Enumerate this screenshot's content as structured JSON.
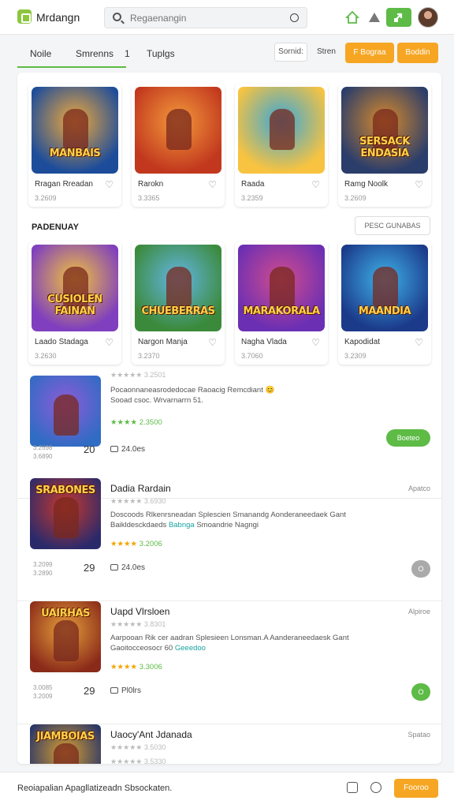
{
  "app": {
    "brand": "Mrdangn"
  },
  "search": {
    "placeholder": "Regaenangin"
  },
  "tabs": [
    "Noile",
    "Smrenns",
    "1",
    "Tuplgs"
  ],
  "toolbar": {
    "filter_label": "Sornid:",
    "filter_value": "Stren",
    "btn1": "F Bograa",
    "btn2": "Boddin"
  },
  "featured": [
    {
      "name": "Rragan Rreadan",
      "count": "3.2609",
      "art": "MANBAIS",
      "colors": [
        "#1d4d9a",
        "#f2a93b"
      ]
    },
    {
      "name": "Rarokn",
      "count": "3.3365",
      "art": "",
      "colors": [
        "#c2381e",
        "#f39a3b"
      ]
    },
    {
      "name": "Raada",
      "count": "3.2359",
      "art": "",
      "colors": [
        "#f7c341",
        "#3aa6d8"
      ]
    },
    {
      "name": "Ramg Noolk",
      "count": "3.2609",
      "art": "SERSACK ENDASIA",
      "colors": [
        "#2a3d6b",
        "#d88a2b"
      ]
    }
  ],
  "section": {
    "title": "PADENUAY",
    "button": "PESC GUNABAS"
  },
  "second": [
    {
      "name": "Laado Stadaga",
      "count": "3.2630",
      "art": "CUSIOLEN FAINAN",
      "colors": [
        "#7f3fbf",
        "#f3c33b"
      ]
    },
    {
      "name": "Nargon Manja",
      "count": "3.2370",
      "art": "CHUEBERRAS",
      "colors": [
        "#3b8a3b",
        "#64b6e6"
      ]
    },
    {
      "name": "Nagha Vlada",
      "count": "3.7060",
      "art": "MARAKORALA",
      "colors": [
        "#6b2fb3",
        "#d24c8e"
      ]
    },
    {
      "name": "Kapodidat",
      "count": "3.2309",
      "art": "MAANDIA",
      "colors": [
        "#1b3a8a",
        "#3fb2e8"
      ]
    }
  ],
  "list": [
    {
      "title": "",
      "date": "",
      "stars_text": "★★★★★ 3.2501",
      "desc": "Pocaonnaneasrodedocae Raoacig Remcdiant 😊",
      "desc2": "Sooad csoc. Wrvarnarrn 51.",
      "highlight": "",
      "green": "★★★★",
      "green_val": "2.3500",
      "size_a": "3.2698",
      "size_b": "3.6890",
      "num": "20",
      "comments": "24.0es",
      "button": "Boeteo",
      "btn_color": "#5dbb46",
      "art": "",
      "colors": [
        "#2f6cc4",
        "#8e5bd6"
      ]
    },
    {
      "title": "Dadia Rardain",
      "date": "Apatco",
      "stars_text": "★★★★★ 3.6930",
      "desc": "Doscoods Rlkenrsneadan Splescien Smanandg Aonderaneedaek Gant",
      "desc2": "Baikldesckdaeds",
      "highlight": "Babnga",
      "desc3": "Smoandrie Nagngi",
      "green": "★★★★",
      "green_val": "3.2006",
      "size_a": "3.2099",
      "size_b": "3.2890",
      "num": "29",
      "comments": "24.0es",
      "button": "O",
      "btn_color": "#aaaaaa",
      "art": "SRABONES",
      "colors": [
        "#2a2a6b",
        "#c8382e"
      ]
    },
    {
      "title": "Uapd Vlrsloen",
      "date": "Alpiroe",
      "stars_text": "★★★★★ 3.8301",
      "desc": "Aarpooan Rik cer aadran Splesieen Lonsman.A Aanderaneedaesk Gant",
      "desc2": "Gaoitocceosocr 60",
      "highlight": "Geeedoo",
      "desc3": "",
      "green": "★★★★",
      "green_val": "3.3006",
      "size_a": "3.0085",
      "size_b": "3.2009",
      "num": "29",
      "comments": "Pl0lrs",
      "button": "O",
      "btn_color": "#5dbb46",
      "art": "UAIRHAS",
      "colors": [
        "#8a2a1a",
        "#e6a03a"
      ]
    },
    {
      "title": "Uaocy'Ant Jdanada",
      "date": "Spatao",
      "stars_text": "★★★★★ 3.5030",
      "stars2": "★★★★★ 3.5330",
      "art": "JIAMBOIAS",
      "colors": [
        "#1f2f6b",
        "#d9a030"
      ]
    }
  ],
  "footer": {
    "text": "Reoiapalian Apagllatizeadn Sbsockaten.",
    "button": "Fooroo"
  }
}
